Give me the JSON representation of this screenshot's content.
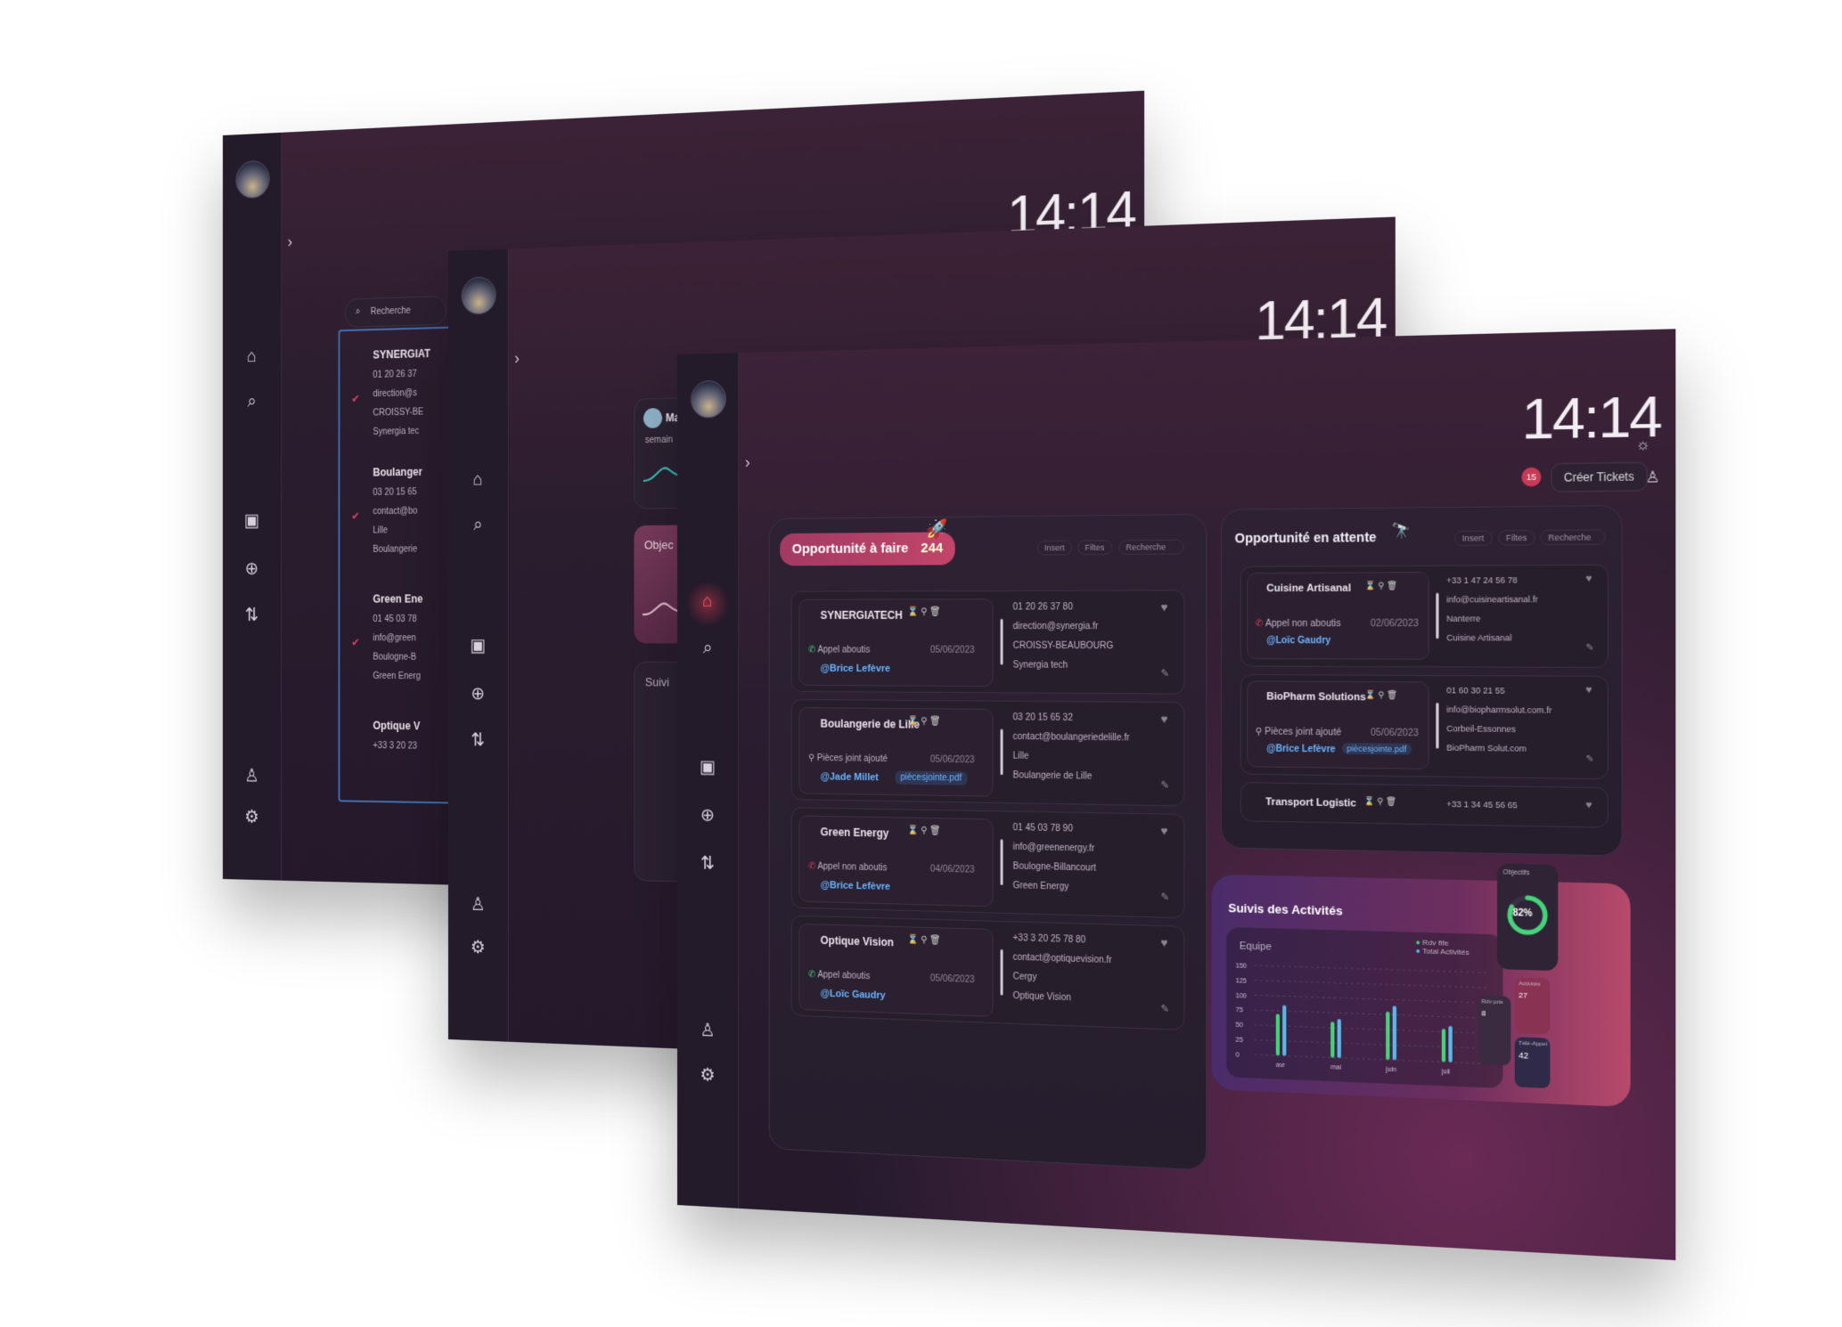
{
  "time": "14:14",
  "notification_count": "15",
  "create_button": "Créer Tickets",
  "back_screen": {
    "search_placeholder": "Recherche",
    "items": [
      {
        "name": "SYNERGIAT",
        "phone": "01 20 26 37",
        "email": "direction@s",
        "city": "CROISSY-BE",
        "company": "Synergia tec"
      },
      {
        "name": "Boulanger",
        "phone": "03 20 15 65",
        "email": "contact@bo",
        "city": "Lille",
        "company": "Boulangerie"
      },
      {
        "name": "Green Ene",
        "phone": "01 45 03 78",
        "email": "info@green",
        "city": "Boulogne-B",
        "company": "Green Energ"
      },
      {
        "name": "Optique V",
        "phone": "+33 3 20 23"
      }
    ]
  },
  "middle_screen": {
    "card_name": "Ma",
    "card_sub": "semain",
    "objective": "Objec",
    "suivi": "Suivi"
  },
  "todo": {
    "title": "Opportunité à faire",
    "count": "244",
    "toolbar": {
      "insert": "Insert",
      "filter": "Filtes",
      "search": "Recherche"
    },
    "items": [
      {
        "name": "SYNERGIATECH",
        "status": "Appel aboutis",
        "date": "05/06/2023",
        "mention": "@Brice Lefèvre",
        "phone": "01 20 26 37 80",
        "email": "direction@synergia.fr",
        "city": "CROISSY-BEAUBOURG",
        "company": "Synergia tech",
        "attachment": ""
      },
      {
        "name": "Boulangerie de Lille",
        "status": "Pièces joint ajouté",
        "date": "05/06/2023",
        "mention": "@Jade Millet",
        "phone": "03 20 15 65 32",
        "email": "contact@boulangeriedelille.fr",
        "city": "Lille",
        "company": "Boulangerie de Lille",
        "attachment": "piècesjointe.pdf"
      },
      {
        "name": "Green Energy",
        "status": "Appel non aboutis",
        "date": "04/06/2023",
        "mention": "@Brice Lefèvre",
        "phone": "01 45 03 78 90",
        "email": "info@greenenergy.fr",
        "city": "Boulogne-Billancourt",
        "company": "Green Energy",
        "attachment": ""
      },
      {
        "name": "Optique Vision",
        "status": "Appel aboutis",
        "date": "05/06/2023",
        "mention": "@Loïc Gaudry",
        "phone": "+33 3 20 25 78 80",
        "email": "contact@optiquevision.fr",
        "city": "Cergy",
        "company": "Optique Vision",
        "attachment": ""
      }
    ]
  },
  "waiting": {
    "title": "Opportunité en attente",
    "toolbar": {
      "insert": "Insert",
      "filter": "Filtes",
      "search": "Recherche"
    },
    "items": [
      {
        "name": "Cuisine Artisanal",
        "status": "Appel non aboutis",
        "date": "02/06/2023",
        "mention": "@Loïc Gaudry",
        "phone": "+33 1 47 24 56 78",
        "email": "info@cuisineartisanal.fr",
        "city": "Nanterre",
        "company": "Cuisine Artisanal",
        "attachment": ""
      },
      {
        "name": "BioPharm Solutions",
        "status": "Pièces joint ajouté",
        "date": "05/06/2023",
        "mention": "@Brice Lefèvre",
        "phone": "01 60 30 21 55",
        "email": "info@biopharmsolut.com.fr",
        "city": "Corbeil-Essonnes",
        "company": "BioPharm Solut.com",
        "attachment": "piècesjointe.pdf"
      },
      {
        "name": "Transport Logistic",
        "phone": "+33 1 34 45 56 65"
      }
    ]
  },
  "activity": {
    "title": "Suivis des Activités",
    "team_label": "Equipe",
    "legend": [
      "Rdv fife",
      "Total Activités"
    ],
    "y_ticks": [
      "150",
      "125",
      "100",
      "75",
      "50",
      "25",
      "0"
    ],
    "x_labels": [
      "avr",
      "mai",
      "juin",
      "juil"
    ],
    "objectifs_label": "Objectifs",
    "percent": "82%",
    "mini_cards": [
      {
        "label": "Activités",
        "value": "27"
      },
      {
        "label": "Rdv pris",
        "value": "8"
      },
      {
        "label": "Télé-Appel",
        "value": "42"
      }
    ]
  },
  "chart_data": {
    "type": "bar",
    "categories": [
      "avr",
      "mai",
      "juin",
      "juil"
    ],
    "series": [
      {
        "name": "Rdv fife",
        "values": [
          70,
          60,
          80,
          55
        ]
      },
      {
        "name": "Total Activités",
        "values": [
          85,
          65,
          90,
          60
        ]
      }
    ],
    "ylim": [
      0,
      150
    ]
  },
  "colors": {
    "accent": "#e0405e",
    "mention": "#6ab4ff",
    "green": "#46d37a",
    "red": "#e0405e"
  }
}
